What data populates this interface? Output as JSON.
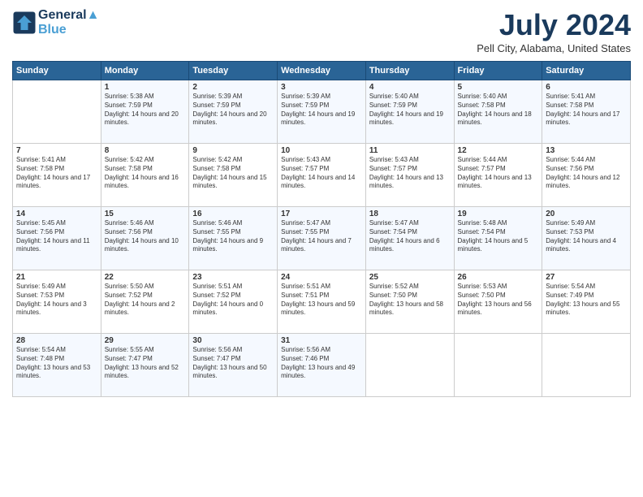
{
  "header": {
    "logo_line1": "General",
    "logo_line2": "Blue",
    "month_year": "July 2024",
    "location": "Pell City, Alabama, United States"
  },
  "weekdays": [
    "Sunday",
    "Monday",
    "Tuesday",
    "Wednesday",
    "Thursday",
    "Friday",
    "Saturday"
  ],
  "weeks": [
    [
      {
        "day": "",
        "sunrise": "",
        "sunset": "",
        "daylight": ""
      },
      {
        "day": "1",
        "sunrise": "Sunrise: 5:38 AM",
        "sunset": "Sunset: 7:59 PM",
        "daylight": "Daylight: 14 hours and 20 minutes."
      },
      {
        "day": "2",
        "sunrise": "Sunrise: 5:39 AM",
        "sunset": "Sunset: 7:59 PM",
        "daylight": "Daylight: 14 hours and 20 minutes."
      },
      {
        "day": "3",
        "sunrise": "Sunrise: 5:39 AM",
        "sunset": "Sunset: 7:59 PM",
        "daylight": "Daylight: 14 hours and 19 minutes."
      },
      {
        "day": "4",
        "sunrise": "Sunrise: 5:40 AM",
        "sunset": "Sunset: 7:59 PM",
        "daylight": "Daylight: 14 hours and 19 minutes."
      },
      {
        "day": "5",
        "sunrise": "Sunrise: 5:40 AM",
        "sunset": "Sunset: 7:58 PM",
        "daylight": "Daylight: 14 hours and 18 minutes."
      },
      {
        "day": "6",
        "sunrise": "Sunrise: 5:41 AM",
        "sunset": "Sunset: 7:58 PM",
        "daylight": "Daylight: 14 hours and 17 minutes."
      }
    ],
    [
      {
        "day": "7",
        "sunrise": "Sunrise: 5:41 AM",
        "sunset": "Sunset: 7:58 PM",
        "daylight": "Daylight: 14 hours and 17 minutes."
      },
      {
        "day": "8",
        "sunrise": "Sunrise: 5:42 AM",
        "sunset": "Sunset: 7:58 PM",
        "daylight": "Daylight: 14 hours and 16 minutes."
      },
      {
        "day": "9",
        "sunrise": "Sunrise: 5:42 AM",
        "sunset": "Sunset: 7:58 PM",
        "daylight": "Daylight: 14 hours and 15 minutes."
      },
      {
        "day": "10",
        "sunrise": "Sunrise: 5:43 AM",
        "sunset": "Sunset: 7:57 PM",
        "daylight": "Daylight: 14 hours and 14 minutes."
      },
      {
        "day": "11",
        "sunrise": "Sunrise: 5:43 AM",
        "sunset": "Sunset: 7:57 PM",
        "daylight": "Daylight: 14 hours and 13 minutes."
      },
      {
        "day": "12",
        "sunrise": "Sunrise: 5:44 AM",
        "sunset": "Sunset: 7:57 PM",
        "daylight": "Daylight: 14 hours and 13 minutes."
      },
      {
        "day": "13",
        "sunrise": "Sunrise: 5:44 AM",
        "sunset": "Sunset: 7:56 PM",
        "daylight": "Daylight: 14 hours and 12 minutes."
      }
    ],
    [
      {
        "day": "14",
        "sunrise": "Sunrise: 5:45 AM",
        "sunset": "Sunset: 7:56 PM",
        "daylight": "Daylight: 14 hours and 11 minutes."
      },
      {
        "day": "15",
        "sunrise": "Sunrise: 5:46 AM",
        "sunset": "Sunset: 7:56 PM",
        "daylight": "Daylight: 14 hours and 10 minutes."
      },
      {
        "day": "16",
        "sunrise": "Sunrise: 5:46 AM",
        "sunset": "Sunset: 7:55 PM",
        "daylight": "Daylight: 14 hours and 9 minutes."
      },
      {
        "day": "17",
        "sunrise": "Sunrise: 5:47 AM",
        "sunset": "Sunset: 7:55 PM",
        "daylight": "Daylight: 14 hours and 7 minutes."
      },
      {
        "day": "18",
        "sunrise": "Sunrise: 5:47 AM",
        "sunset": "Sunset: 7:54 PM",
        "daylight": "Daylight: 14 hours and 6 minutes."
      },
      {
        "day": "19",
        "sunrise": "Sunrise: 5:48 AM",
        "sunset": "Sunset: 7:54 PM",
        "daylight": "Daylight: 14 hours and 5 minutes."
      },
      {
        "day": "20",
        "sunrise": "Sunrise: 5:49 AM",
        "sunset": "Sunset: 7:53 PM",
        "daylight": "Daylight: 14 hours and 4 minutes."
      }
    ],
    [
      {
        "day": "21",
        "sunrise": "Sunrise: 5:49 AM",
        "sunset": "Sunset: 7:53 PM",
        "daylight": "Daylight: 14 hours and 3 minutes."
      },
      {
        "day": "22",
        "sunrise": "Sunrise: 5:50 AM",
        "sunset": "Sunset: 7:52 PM",
        "daylight": "Daylight: 14 hours and 2 minutes."
      },
      {
        "day": "23",
        "sunrise": "Sunrise: 5:51 AM",
        "sunset": "Sunset: 7:52 PM",
        "daylight": "Daylight: 14 hours and 0 minutes."
      },
      {
        "day": "24",
        "sunrise": "Sunrise: 5:51 AM",
        "sunset": "Sunset: 7:51 PM",
        "daylight": "Daylight: 13 hours and 59 minutes."
      },
      {
        "day": "25",
        "sunrise": "Sunrise: 5:52 AM",
        "sunset": "Sunset: 7:50 PM",
        "daylight": "Daylight: 13 hours and 58 minutes."
      },
      {
        "day": "26",
        "sunrise": "Sunrise: 5:53 AM",
        "sunset": "Sunset: 7:50 PM",
        "daylight": "Daylight: 13 hours and 56 minutes."
      },
      {
        "day": "27",
        "sunrise": "Sunrise: 5:54 AM",
        "sunset": "Sunset: 7:49 PM",
        "daylight": "Daylight: 13 hours and 55 minutes."
      }
    ],
    [
      {
        "day": "28",
        "sunrise": "Sunrise: 5:54 AM",
        "sunset": "Sunset: 7:48 PM",
        "daylight": "Daylight: 13 hours and 53 minutes."
      },
      {
        "day": "29",
        "sunrise": "Sunrise: 5:55 AM",
        "sunset": "Sunset: 7:47 PM",
        "daylight": "Daylight: 13 hours and 52 minutes."
      },
      {
        "day": "30",
        "sunrise": "Sunrise: 5:56 AM",
        "sunset": "Sunset: 7:47 PM",
        "daylight": "Daylight: 13 hours and 50 minutes."
      },
      {
        "day": "31",
        "sunrise": "Sunrise: 5:56 AM",
        "sunset": "Sunset: 7:46 PM",
        "daylight": "Daylight: 13 hours and 49 minutes."
      },
      {
        "day": "",
        "sunrise": "",
        "sunset": "",
        "daylight": ""
      },
      {
        "day": "",
        "sunrise": "",
        "sunset": "",
        "daylight": ""
      },
      {
        "day": "",
        "sunrise": "",
        "sunset": "",
        "daylight": ""
      }
    ]
  ]
}
